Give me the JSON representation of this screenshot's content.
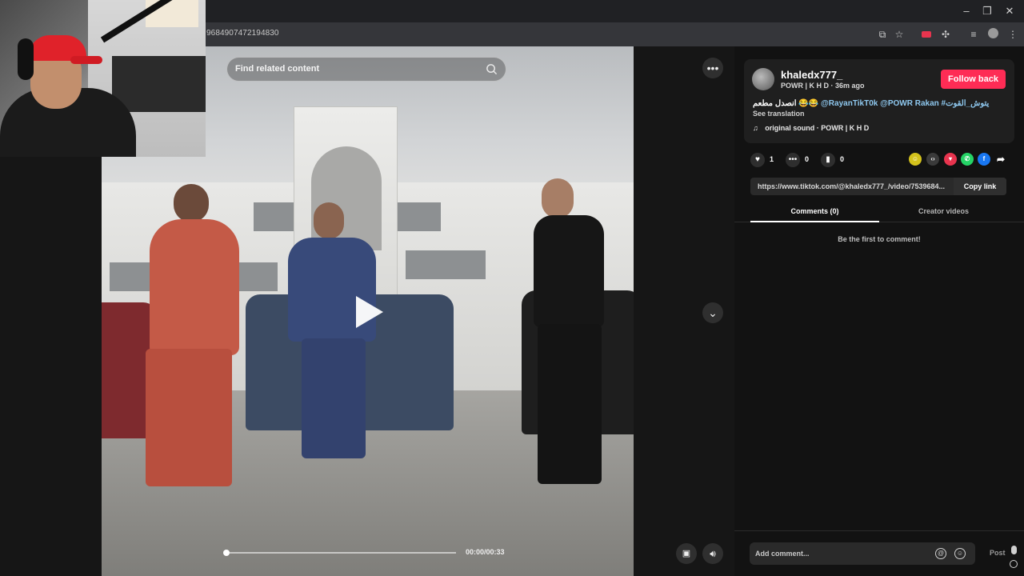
{
  "browser": {
    "url": "96849074721948​30",
    "window_controls": {
      "minimize": "–",
      "restore": "❐",
      "close": "✕"
    }
  },
  "search": {
    "placeholder": "Find related content"
  },
  "video": {
    "timecode": "00:00/00:33",
    "progress_fraction": 0.0
  },
  "post": {
    "username": "khaledx777_",
    "subline": "POWR | K H D · 36m ago",
    "follow_label": "Follow back",
    "caption_prefix": "انصدل مطعم 😂😂 ",
    "caption_tags": "@RayanTikT0k @POWR Rakan #يتوش_القوت",
    "see_translation": "See translation",
    "sound_note": "♫",
    "sound": "original sound · POWR | K H D"
  },
  "stats": {
    "likes": "1",
    "comments": "0",
    "saves": "0"
  },
  "link": {
    "url": "https://www.tiktok.com/@khaledx777_/video/7539684...",
    "copy_label": "Copy link"
  },
  "tabs": {
    "comments": "Comments (0)",
    "creator_videos": "Creator videos"
  },
  "empty_comments": "Be the first to comment!",
  "comment_box": {
    "placeholder": "Add comment...",
    "post_label": "Post"
  },
  "colors": {
    "follow": "#fe2c55",
    "tag": "#8fc9f0",
    "panel_bg": "#121212"
  }
}
